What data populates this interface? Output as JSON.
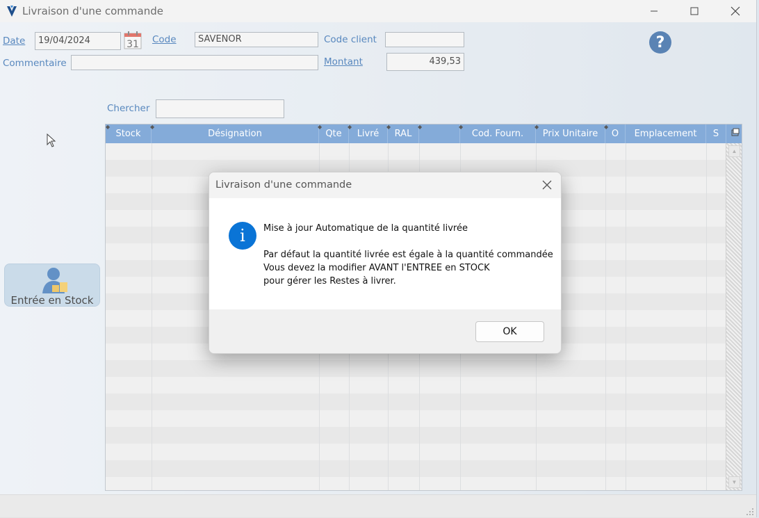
{
  "window": {
    "title": "Livraison d'une commande"
  },
  "form": {
    "date_label": "Date",
    "date_value": "19/04/2024",
    "calendar_day": "31",
    "code_label": "Code",
    "code_value": "SAVENOR",
    "code_client_label": "Code client",
    "code_client_value": "",
    "commentaire_label": "Commentaire",
    "commentaire_value": "",
    "montant_label": "Montant",
    "montant_value": "439,53",
    "chercher_label": "Chercher",
    "chercher_value": "",
    "help_glyph": "?"
  },
  "grid": {
    "columns": [
      "Stock",
      "Désignation",
      "Qte",
      "Livré",
      "RAL",
      "",
      "Cod. Fourn.",
      "Prix Unitaire",
      "O",
      "Emplacement",
      "S"
    ]
  },
  "stock_button": {
    "label": "Entrée en Stock"
  },
  "dialog": {
    "title": "Livraison d'une commande",
    "info_glyph": "i",
    "line1": "Mise à jour Automatique de la quantité livrée",
    "line2": "Par défaut la quantité livrée est égale à la quantité commandée",
    "line3": "Vous devez la modifier AVANT l'ENTREE en STOCK",
    "line4": "pour gérer les Restes à livrer.",
    "ok_label": "OK"
  },
  "colors": {
    "accent": "#1f5fa8",
    "grid_header": "#5b8fcc",
    "info": "#0a74d6"
  }
}
